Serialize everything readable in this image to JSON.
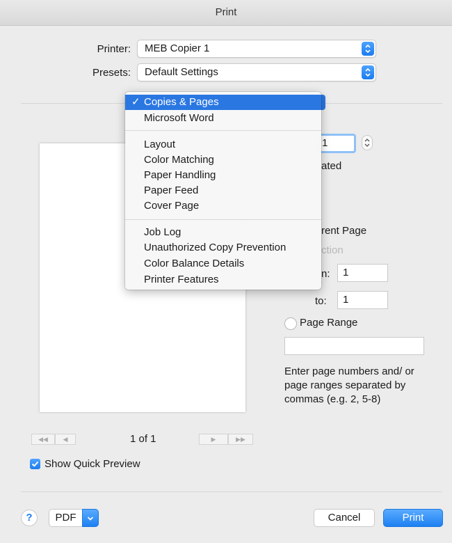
{
  "window": {
    "title": "Print"
  },
  "printer": {
    "label": "Printer:",
    "value": "MEB Copier 1"
  },
  "presets": {
    "label": "Presets:",
    "value": "Default Settings"
  },
  "menu": {
    "items": [
      {
        "label": "Copies & Pages",
        "selected": true
      },
      {
        "label": "Microsoft Word"
      },
      {
        "label": "Layout"
      },
      {
        "label": "Color Matching"
      },
      {
        "label": "Paper Handling"
      },
      {
        "label": "Paper Feed"
      },
      {
        "label": "Cover Page"
      },
      {
        "label": "Job Log"
      },
      {
        "label": "Unauthorized Copy Prevention"
      },
      {
        "label": "Color Balance Details"
      },
      {
        "label": "Printer Features"
      }
    ],
    "checkmark": "✓"
  },
  "copies": {
    "value": "1",
    "collated_fragment": "ated"
  },
  "pages": {
    "current_page_fragment": "rent Page",
    "selection_fragment": "ction",
    "from_label_fragment": "n:",
    "from_value": "1",
    "to_label": "to:",
    "to_value": "1",
    "page_range_label": "Page Range",
    "page_range_value": "",
    "help_text": "Enter page numbers and/ or page ranges separated by commas (e.g. 2, 5-8)"
  },
  "preview": {
    "page_indicator": "1 of 1",
    "first_label": "◀◀",
    "prev_label": "◀",
    "next_label": "▶",
    "last_label": "▶▶"
  },
  "quick_preview": {
    "label": "Show Quick Preview",
    "checked": true
  },
  "footer": {
    "help_label": "?",
    "pdf_label": "PDF",
    "cancel_label": "Cancel",
    "print_label": "Print"
  },
  "colors": {
    "accent": "#1b7cf0",
    "menu_highlight": "#2a77e2"
  }
}
